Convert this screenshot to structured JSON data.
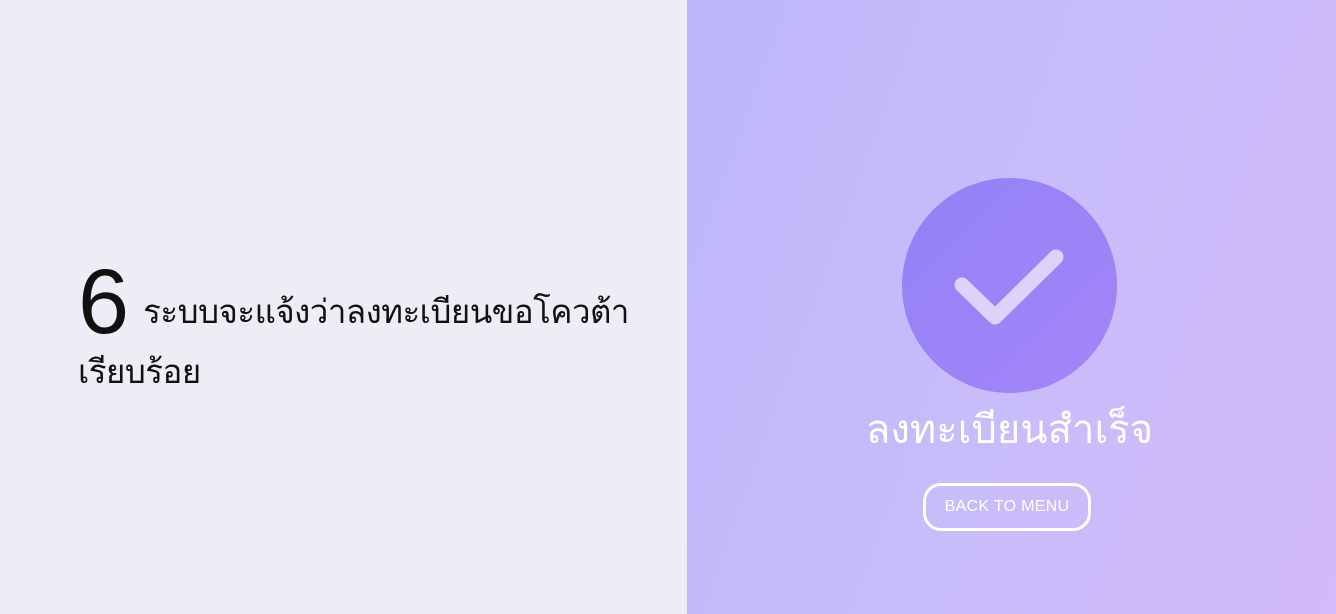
{
  "instruction": {
    "step_number": "6",
    "text": "ระบบจะแจ้งว่าลงทะเบียนขอโควต้าเรียบร้อย"
  },
  "success_screen": {
    "icon": "check-icon",
    "title": "ลงทะเบียนสำเร็จ",
    "back_button_label": "BACK TO MENU"
  },
  "colors": {
    "left_background": "#eeedf5",
    "gradient_start": "#bcb6fb",
    "gradient_end": "#d3bafa",
    "circle": "#9b83f7",
    "text_light": "#ffffff"
  }
}
